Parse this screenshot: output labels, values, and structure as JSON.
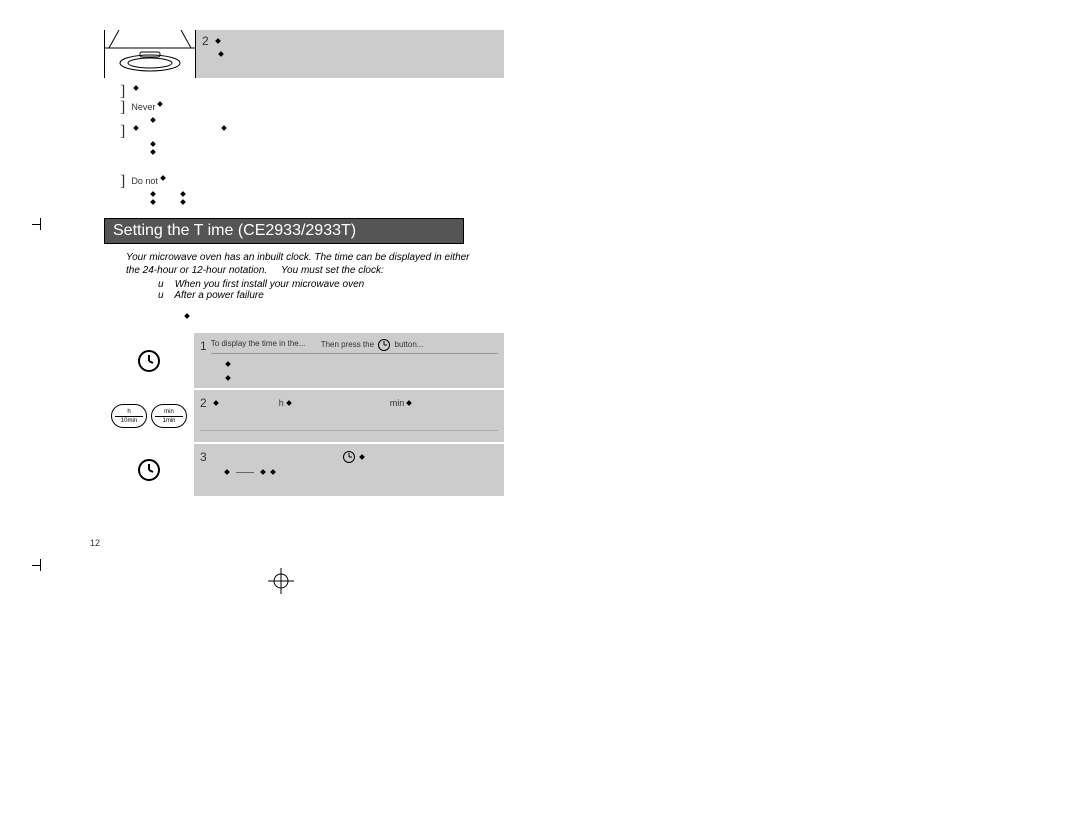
{
  "top_step_num": "2",
  "notes": {
    "never": "Never",
    "donot": "Do not"
  },
  "heading": "Setting the T ime (CE2933/2933T)",
  "intro_line1": "Your microwave oven has an inbuilt clock. The time can be displayed in either",
  "intro_line2": "the 24-hour or 12-hour notation.",
  "intro_line2b": "You must set the clock:",
  "bullet_u1": "When you first install your microwave oven",
  "bullet_u2": "After a power failure",
  "u_marker": "u",
  "step1": {
    "num": "1",
    "col1": "To display the time in the...",
    "col2_a": "Then press the",
    "col2_b": "button..."
  },
  "step2": {
    "num": "2",
    "h_label": "h",
    "min_label": "min"
  },
  "step3": {
    "num": "3"
  },
  "oval": {
    "h_top": "h",
    "h_bot": "10min",
    "m_top": "min",
    "m_bot": "1min"
  },
  "page_number": "12"
}
